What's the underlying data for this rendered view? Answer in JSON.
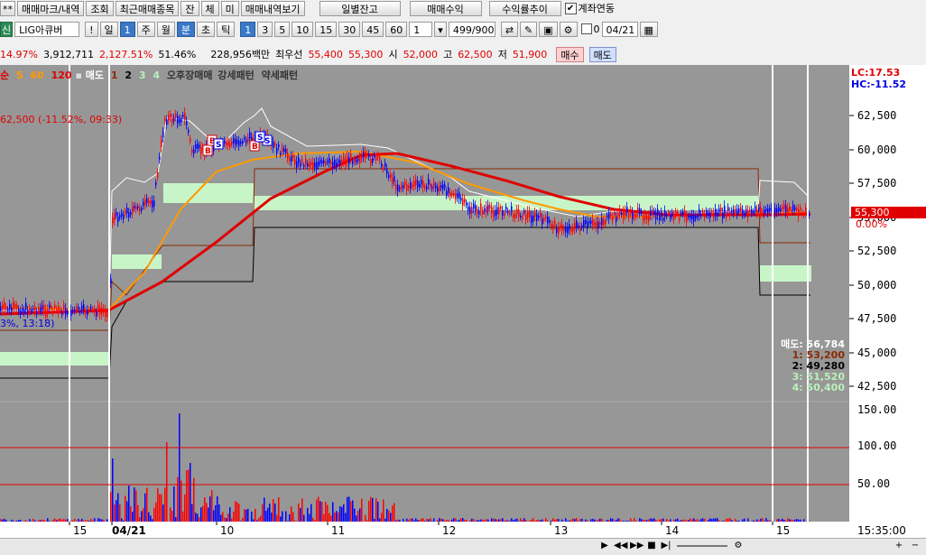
{
  "toolbar1": {
    "prefix": "**",
    "tab_mark": "매매마크/내역",
    "tab_query": "조회",
    "tab_recent": "최근매매종목",
    "tab_balance": "잔",
    "tab_fill": "체",
    "tab_unfilled": "미",
    "tab_history": "매매내역보기",
    "daily_balance": "일별잔고",
    "trade_profit": "매매수익",
    "profit_rate": "수익률추이",
    "account_link_label": "계좌연동",
    "account_link_checked": true
  },
  "toolbar2": {
    "code_prefix": "신",
    "stock_name": "LIG아큐버",
    "exclaim": "!",
    "period_day": "일",
    "period_value": "1",
    "period_week": "주",
    "period_month": "월",
    "period_minute": "분",
    "period_second": "초",
    "period_tick": "틱",
    "intervals": [
      "1",
      "3",
      "5",
      "10",
      "15",
      "30",
      "45",
      "60"
    ],
    "interval_select": "1",
    "count": "499",
    "count_total": "900",
    "date_value": "04/21",
    "date_checkbox": "0"
  },
  "info": {
    "change_rate": "14.97%",
    "volume": "3,912,711",
    "vol_ratio": "2,127.51%",
    "turnover": "51.46%",
    "amount": "228,956백만",
    "best_label": "최우선",
    "ask": "55,400",
    "bid": "55,300",
    "open_label": "시",
    "open": "52,000",
    "high_label": "고",
    "high": "62,500",
    "low_label": "저",
    "low": "51,900",
    "buy_btn": "매수",
    "sell_btn": "매도"
  },
  "legend": {
    "ma_label": "순",
    "ma5": "5",
    "ma60": "60",
    "ma120": "120",
    "sell_label": "매도",
    "l1": "1",
    "l2": "2",
    "l3": "3",
    "l4": "4",
    "pattern1": "오후장매매",
    "pattern2": "강세패턴",
    "pattern3": "약세패턴"
  },
  "overlay": {
    "lc": "LC:17.53",
    "hc": "HC:-11.52",
    "high_note": "62,500 (-11.52%, 09:33)",
    "low_note": "3%, 13:18)",
    "cur_price": "55,300",
    "cur_rate": "0.00%",
    "levels": [
      {
        "label": "매도: 56,784",
        "color": "#ffffff"
      },
      {
        "label": "1: 53,200",
        "color": "#8b2a00"
      },
      {
        "label": "2: 49,280",
        "color": "#000000"
      },
      {
        "label": "3: 51,520",
        "color": "#b8f0b8"
      },
      {
        "label": "4: 50,400",
        "color": "#b8f0b8"
      }
    ]
  },
  "axis": {
    "price_ticks": [
      "62,500",
      "60,000",
      "57,500",
      "55,000",
      "52,500",
      "50,000",
      "47,500",
      "45,000",
      "42,500"
    ],
    "volume_ticks": [
      "150.00",
      "100.00",
      "50.00"
    ],
    "x_labels": [
      "15",
      "04/21",
      "10",
      "11",
      "12",
      "13",
      "14",
      "15"
    ],
    "time_label": "15:35:00"
  },
  "colors": {
    "chart_bg": "#979797",
    "band": "#c8f5c8",
    "ma5": "#ffffff",
    "ma60": "#ff9900",
    "ma120": "#e00000",
    "up": "#ff0000",
    "down": "#0000ff"
  },
  "status": {
    "icons": [
      "play-icon",
      "rewind-icon",
      "fast-forward-icon",
      "stop-icon",
      "step-icon",
      "settings-icon",
      "zoom-in-icon",
      "zoom-out-icon"
    ]
  }
}
